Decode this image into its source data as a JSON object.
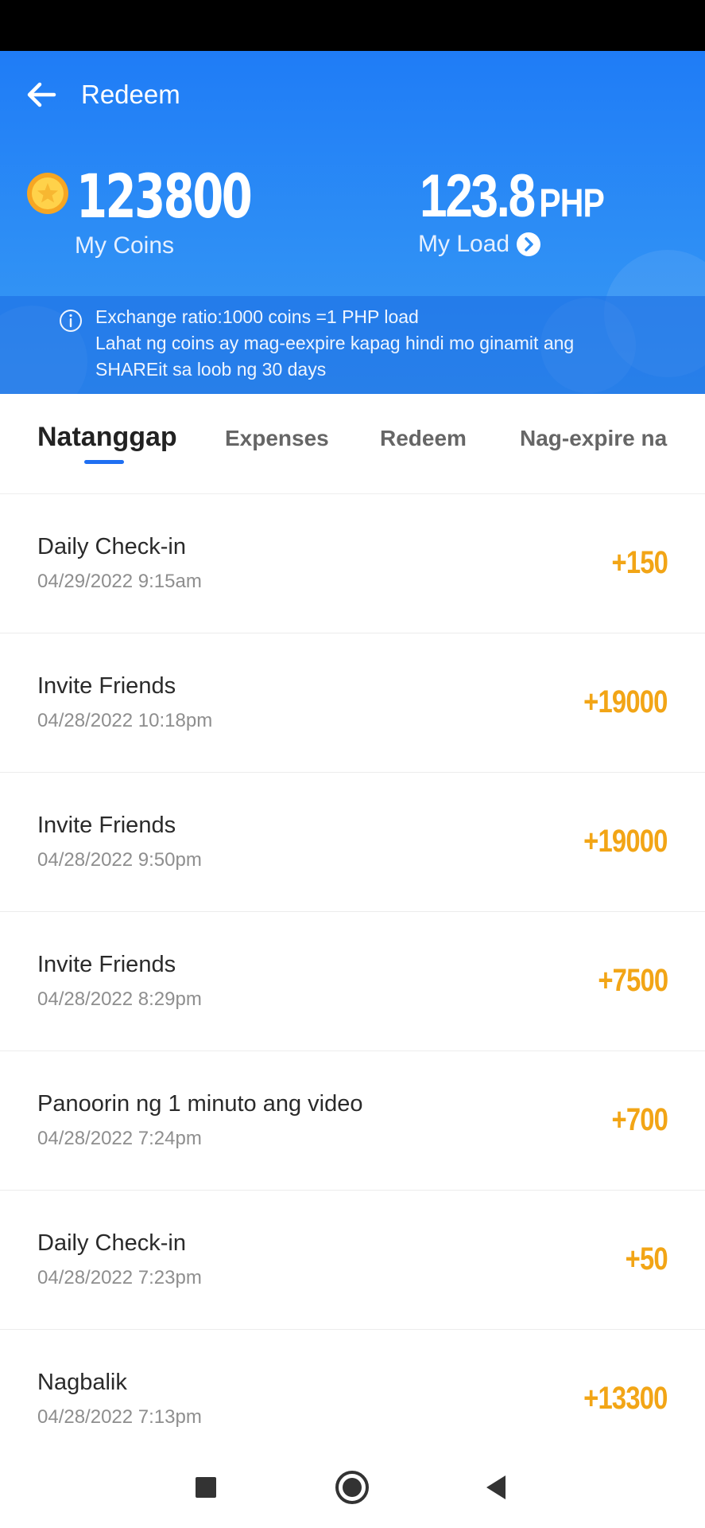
{
  "header": {
    "title": "Redeem",
    "coins_value": "123800",
    "coins_label": "My Coins",
    "load_value": "123.8",
    "load_unit": "PHP",
    "load_label": "My Load",
    "notice_line1": "Exchange ratio:1000 coins =1 PHP load",
    "notice_line2": "Lahat ng coins ay mag-eexpire kapag hindi mo ginamit ang",
    "notice_line3": "SHAREit sa loob ng 30 days"
  },
  "tabs": [
    {
      "label": "Natanggap",
      "active": true
    },
    {
      "label": "Expenses",
      "active": false
    },
    {
      "label": "Redeem",
      "active": false
    },
    {
      "label": "Nag-expire na",
      "active": false
    }
  ],
  "transactions": [
    {
      "title": "Daily Check-in",
      "time": "04/29/2022 9:15am",
      "amount": "+150"
    },
    {
      "title": "Invite Friends",
      "time": "04/28/2022 10:18pm",
      "amount": "+19000"
    },
    {
      "title": "Invite Friends",
      "time": "04/28/2022 9:50pm",
      "amount": "+19000"
    },
    {
      "title": "Invite Friends",
      "time": "04/28/2022 8:29pm",
      "amount": "+7500"
    },
    {
      "title": "Panoorin ng 1 minuto ang video",
      "time": "04/28/2022 7:24pm",
      "amount": "+700"
    },
    {
      "title": "Daily Check-in",
      "time": "04/28/2022 7:23pm",
      "amount": "+50"
    },
    {
      "title": "Nagbalik",
      "time": "04/28/2022 7:13pm",
      "amount": "+13300"
    }
  ],
  "icons": {
    "back": "arrow-left-icon",
    "coin": "coin-icon",
    "chevron": "chevron-right-circle-icon",
    "info": "info-icon",
    "nav_recent": "square-icon",
    "nav_home": "circle-icon",
    "nav_back": "triangle-back-icon"
  },
  "colors": {
    "header_blue": "#1f7cf6",
    "amount_orange": "#f2a516",
    "tab_indicator": "#1f6ff2"
  }
}
